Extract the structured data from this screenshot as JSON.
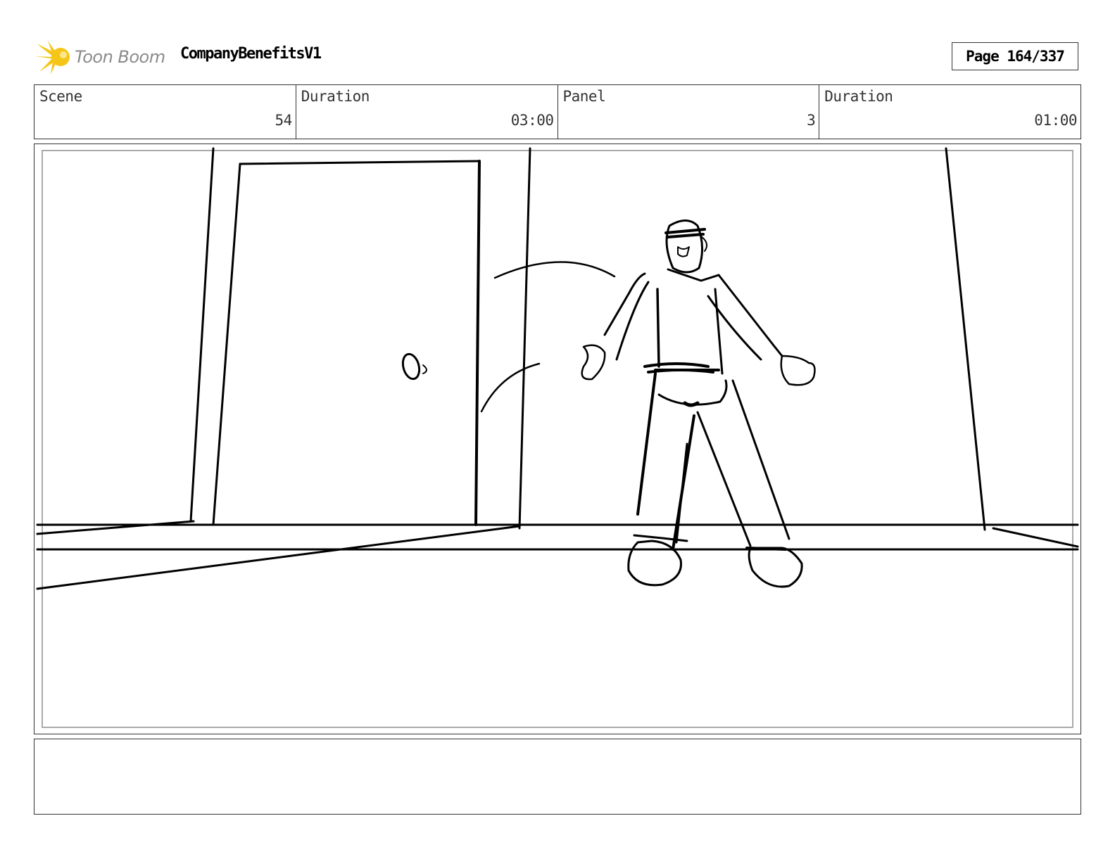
{
  "header": {
    "logo_text": "Toon Boom",
    "project_title": "CompanyBenefitsV1",
    "page_label": "Page 164/337"
  },
  "info": {
    "scene_label": "Scene",
    "scene_value": "54",
    "scene_duration_label": "Duration",
    "scene_duration_value": "03:00",
    "panel_label": "Panel",
    "panel_value": "3",
    "panel_duration_label": "Duration",
    "panel_duration_value": "01:00"
  },
  "colors": {
    "logo_accent": "#f5c518",
    "logo_text": "#8a8a8a",
    "line": "#000000"
  }
}
